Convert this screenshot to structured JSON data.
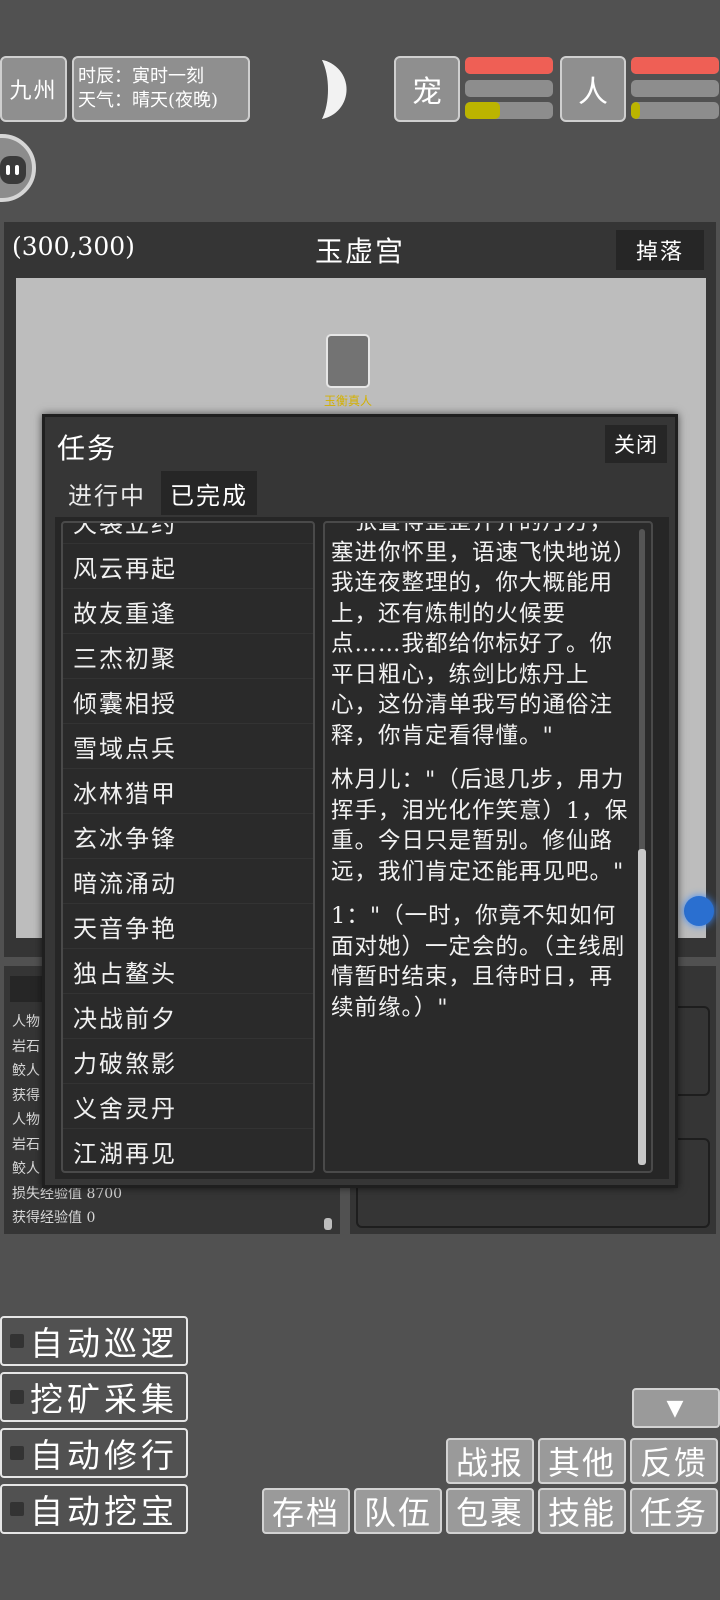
{
  "top": {
    "region_button": "九州",
    "time_label": "时辰：寅时一刻",
    "weather_label": "天气：晴天(夜晚)",
    "pet_button": "宠",
    "person_button": "人",
    "pet_bars": {
      "hp": 1.0,
      "mp": 0.0,
      "exp": 0.4
    },
    "person_bars": {
      "hp": 1.0,
      "mp": 0.0,
      "exp": 0.1
    }
  },
  "map": {
    "coords": "(300,300)",
    "location": "玉虚宫",
    "drop_button": "掉落",
    "npc_name": "玉衡真人"
  },
  "quest_modal": {
    "title": "任务",
    "close_button": "关闭",
    "tabs": [
      {
        "label": "进行中",
        "active": false
      },
      {
        "label": "已完成",
        "active": true
      }
    ],
    "list": [
      "天裂立约",
      "风云再起",
      "故友重逢",
      "三杰初聚",
      "倾囊相授",
      "雪域点兵",
      "冰林猎甲",
      "玄冰争锋",
      "暗流涌动",
      "天音争艳",
      "独占鳌头",
      "决战前夕",
      "力破煞影",
      "义舍灵丹",
      "江湖再见"
    ],
    "detail": [
      "一张叠得整整齐齐的丹方，塞进你怀里，语速飞快地说）我连夜整理的，你大概能用上，还有炼制的火候要点……我都给你标好了。你平日粗心，练剑比炼丹上心，这份清单我写的通俗注释，你肯定看得懂。\"",
      "林月儿：\"（后退几步，用力挥手，泪光化作笑意）1，保重。今日只是暂别。修仙路远，我们肯定还能再见吧。\"",
      "1：\"（一时，你竟不知如何面对她）一定会的。（主线剧情暂时结束，且待时日，再续前缘。）\""
    ]
  },
  "log": {
    "lines": [
      "人物",
      "岩石",
      "鲛人",
      "获得",
      "人物",
      "岩石",
      "鲛人",
      "损失经验值 8700",
      "获得经验值 0"
    ]
  },
  "auto_buttons": [
    "自动巡逻",
    "挖矿采集",
    "自动修行",
    "自动挖宝"
  ],
  "menu": {
    "collapse": "▼",
    "row1": [
      "战报",
      "其他",
      "反馈"
    ],
    "row2": [
      "存档",
      "队伍",
      "包裹",
      "技能",
      "任务"
    ]
  },
  "colors": {
    "background": "#515151",
    "hp": "#ef5f55",
    "exp": "#bcb400",
    "npc_name": "#d4b100"
  }
}
